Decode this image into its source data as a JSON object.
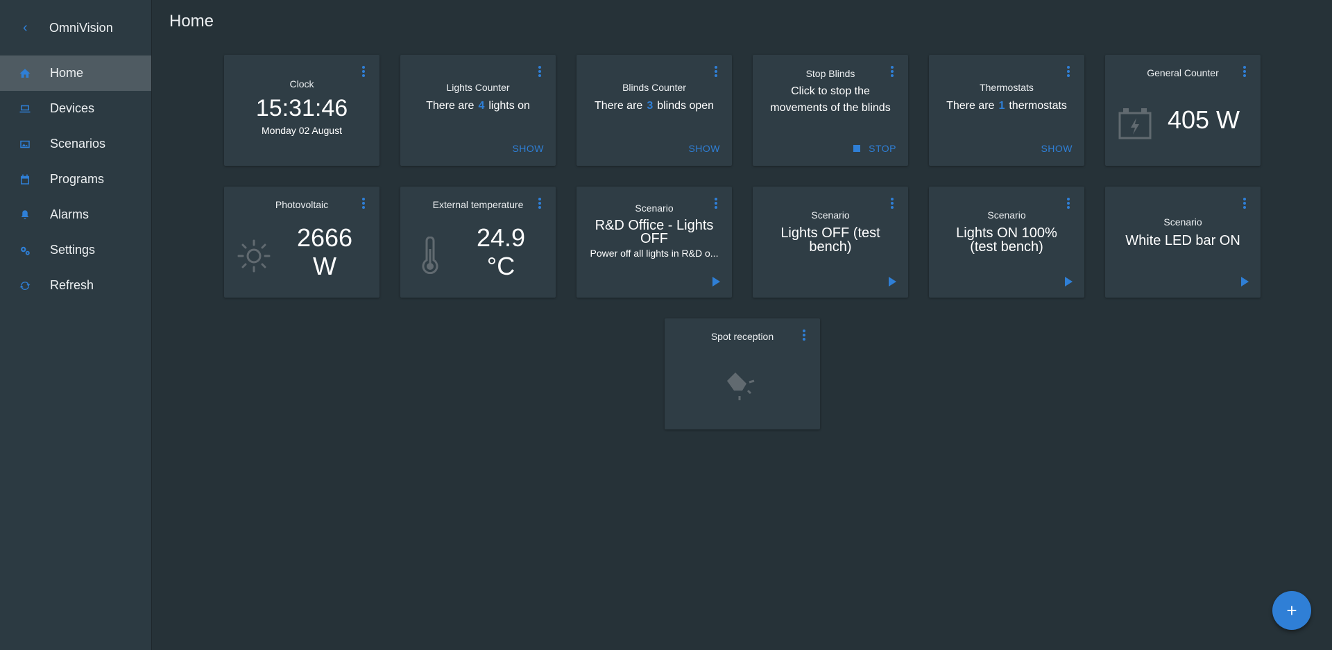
{
  "app": {
    "name": "OmniVision",
    "collapse_icon": "chevron-left-icon"
  },
  "nav": [
    {
      "label": "Home",
      "icon": "home-icon",
      "active": true
    },
    {
      "label": "Devices",
      "icon": "laptop-icon"
    },
    {
      "label": "Scenarios",
      "icon": "image-icon"
    },
    {
      "label": "Programs",
      "icon": "calendar-icon"
    },
    {
      "label": "Alarms",
      "icon": "bell-icon"
    },
    {
      "label": "Settings",
      "icon": "gears-icon"
    },
    {
      "label": "Refresh",
      "icon": "refresh-icon"
    }
  ],
  "page": {
    "title": "Home"
  },
  "colors": {
    "accent": "#2f7fd6",
    "background": "#263238",
    "card": "#2f3d45",
    "sidebar": "#2c3a42"
  },
  "cards": {
    "clock": {
      "title": "Clock",
      "time": "15:31:46",
      "date": "Monday 02 August"
    },
    "lights": {
      "title": "Lights Counter",
      "pre": "There are",
      "count": "4",
      "post": "lights on",
      "action": "SHOW"
    },
    "blinds": {
      "title": "Blinds Counter",
      "pre": "There are",
      "count": "3",
      "post": "blinds open",
      "action": "SHOW"
    },
    "stop_blinds": {
      "title": "Stop Blinds",
      "line1": "Click to stop the",
      "line2": "movements of the blinds",
      "action": "STOP"
    },
    "thermostats": {
      "title": "Thermostats",
      "pre": "There are",
      "count": "1",
      "post": "thermostats",
      "action": "SHOW"
    },
    "general_counter": {
      "title": "General Counter",
      "value": "405 W",
      "icon": "battery-charging-icon"
    },
    "photovoltaic": {
      "title": "Photovoltaic",
      "value_line1": "2666",
      "value_line2": "W",
      "icon": "sun-icon"
    },
    "ext_temp": {
      "title": "External temperature",
      "value_line1": "24.9",
      "value_line2": "°C",
      "icon": "thermometer-icon"
    },
    "scenario1": {
      "title": "Scenario",
      "name_line1": "R&D Office - Lights",
      "name_line2": "OFF",
      "description": "Power off all lights in R&D o..."
    },
    "scenario2": {
      "title": "Scenario",
      "name_line1": "Lights OFF (test",
      "name_line2": "bench)"
    },
    "scenario3": {
      "title": "Scenario",
      "name_line1": "Lights ON 100%",
      "name_line2": "(test bench)"
    },
    "scenario4": {
      "title": "Scenario",
      "name_line1": "White LED bar ON"
    },
    "spot": {
      "title": "Spot reception",
      "icon": "spotlight-icon"
    }
  },
  "fab": {
    "label": "+",
    "icon": "plus-icon"
  }
}
